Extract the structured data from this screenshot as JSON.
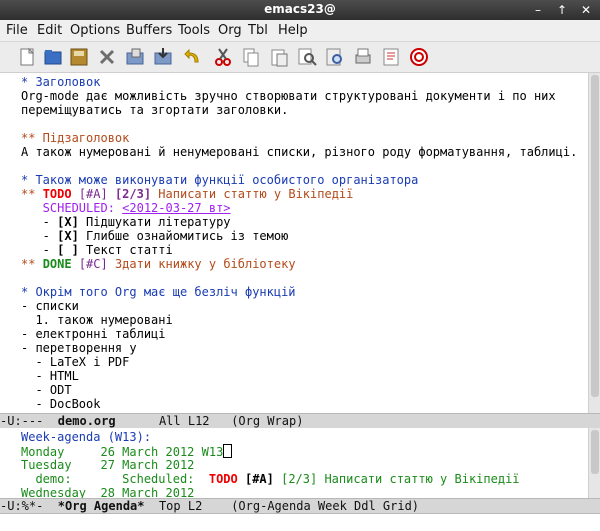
{
  "titlebar": {
    "title": "emacs23@",
    "minimize": "–",
    "up": "↑",
    "close": "✕"
  },
  "menu": [
    "File",
    "Edit",
    "Options",
    "Buffers",
    "Tools",
    "Org",
    "Tbl",
    "Help"
  ],
  "toolbar": {
    "icons": [
      "new-file-icon",
      "open-folder-icon",
      "save-icon",
      "close-icon",
      "folder-save-icon",
      "save-as-icon",
      "undo-icon",
      "cut-icon",
      "copy-icon",
      "paste-icon",
      "search-icon",
      "find-icon",
      "print-icon",
      "preferences-icon",
      "help-icon"
    ]
  },
  "editor": {
    "lines": [
      {
        "spans": [
          {
            "t": "* Заголовок",
            "c": "h1"
          }
        ]
      },
      {
        "spans": [
          {
            "t": "Org-mode дає можливість зручно створювати структуровані документи і по них"
          }
        ]
      },
      {
        "spans": [
          {
            "t": "переміщуватись та згортати заголовки."
          }
        ]
      },
      {
        "spans": [
          {
            "t": ""
          }
        ]
      },
      {
        "spans": [
          {
            "t": "** Підзаголовок",
            "c": "h2"
          }
        ]
      },
      {
        "spans": [
          {
            "t": "А також нумеровані й ненумеровані списки, різного роду форматування, таблиці."
          }
        ]
      },
      {
        "spans": [
          {
            "t": ""
          }
        ]
      },
      {
        "spans": [
          {
            "t": "* Також може виконувати функції особистого організатора",
            "c": "h1"
          }
        ]
      },
      {
        "spans": [
          {
            "t": "** ",
            "c": "h2"
          },
          {
            "t": "TODO",
            "c": "todo"
          },
          {
            "t": " [#A]",
            "c": "prio"
          },
          {
            "t": " [2/3]",
            "c": "cnt"
          },
          {
            "t": " Написати статтю у Вікіпедії",
            "c": "h2"
          }
        ]
      },
      {
        "spans": [
          {
            "t": "   SCHEDULED: ",
            "c": "sched"
          },
          {
            "t": "<2012-03-27 вт>",
            "c": "date"
          }
        ]
      },
      {
        "spans": [
          {
            "t": "   - "
          },
          {
            "t": "[X]",
            "c": "bold"
          },
          {
            "t": " Підшукати літературу"
          }
        ]
      },
      {
        "spans": [
          {
            "t": "   - "
          },
          {
            "t": "[X]",
            "c": "bold"
          },
          {
            "t": " Глибше ознайомитись із темою"
          }
        ]
      },
      {
        "spans": [
          {
            "t": "   - "
          },
          {
            "t": "[ ]",
            "c": "bold"
          },
          {
            "t": " Текст статті"
          }
        ]
      },
      {
        "spans": [
          {
            "t": "** ",
            "c": "h2"
          },
          {
            "t": "DONE",
            "c": "done"
          },
          {
            "t": " [#C]",
            "c": "prio"
          },
          {
            "t": " Здати книжку у бібліотеку",
            "c": "h2"
          }
        ]
      },
      {
        "spans": [
          {
            "t": ""
          }
        ]
      },
      {
        "spans": [
          {
            "t": "* Окрім того Org має ще безліч функцій",
            "c": "h1"
          }
        ]
      },
      {
        "spans": [
          {
            "t": "- списки"
          }
        ]
      },
      {
        "spans": [
          {
            "t": "  1. також нумеровані"
          }
        ]
      },
      {
        "spans": [
          {
            "t": "- електронні таблиці"
          }
        ]
      },
      {
        "spans": [
          {
            "t": "- перетворення у"
          }
        ]
      },
      {
        "spans": [
          {
            "t": "  - LaTeX і PDF"
          }
        ]
      },
      {
        "spans": [
          {
            "t": "  - HTML"
          }
        ]
      },
      {
        "spans": [
          {
            "t": "  - ODT"
          }
        ]
      },
      {
        "spans": [
          {
            "t": "  - DocBook"
          }
        ]
      }
    ]
  },
  "modeline_top": {
    "prefix": "-U:---  ",
    "buffer": "demo.org",
    "rest": "      All L12   (Org Wrap)"
  },
  "agenda": {
    "lines": [
      {
        "spans": [
          {
            "t": "Week-agenda (W13):",
            "c": "blue"
          }
        ]
      },
      {
        "spans": [
          {
            "t": "Monday     26 March 2012 W13",
            "c": "green"
          },
          {
            "t": "",
            "cursor": true
          }
        ]
      },
      {
        "spans": [
          {
            "t": "Tuesday    27 March 2012",
            "c": "green"
          }
        ]
      },
      {
        "spans": [
          {
            "t": "  demo:       Scheduled:  ",
            "c": "green"
          },
          {
            "t": "TODO",
            "c": "todo"
          },
          {
            "t": " [#A]",
            "c": "bold"
          },
          {
            "t": " [2/3] Написати статтю у Вікіпедії",
            "c": "green"
          }
        ]
      },
      {
        "spans": [
          {
            "t": "Wednesday  28 March 2012",
            "c": "green"
          }
        ]
      }
    ]
  },
  "modeline_bottom": {
    "prefix": "-U:%*-  ",
    "buffer": "*Org Agenda*",
    "rest": "  Top L2    (Org-Agenda Week Ddl Grid)"
  }
}
